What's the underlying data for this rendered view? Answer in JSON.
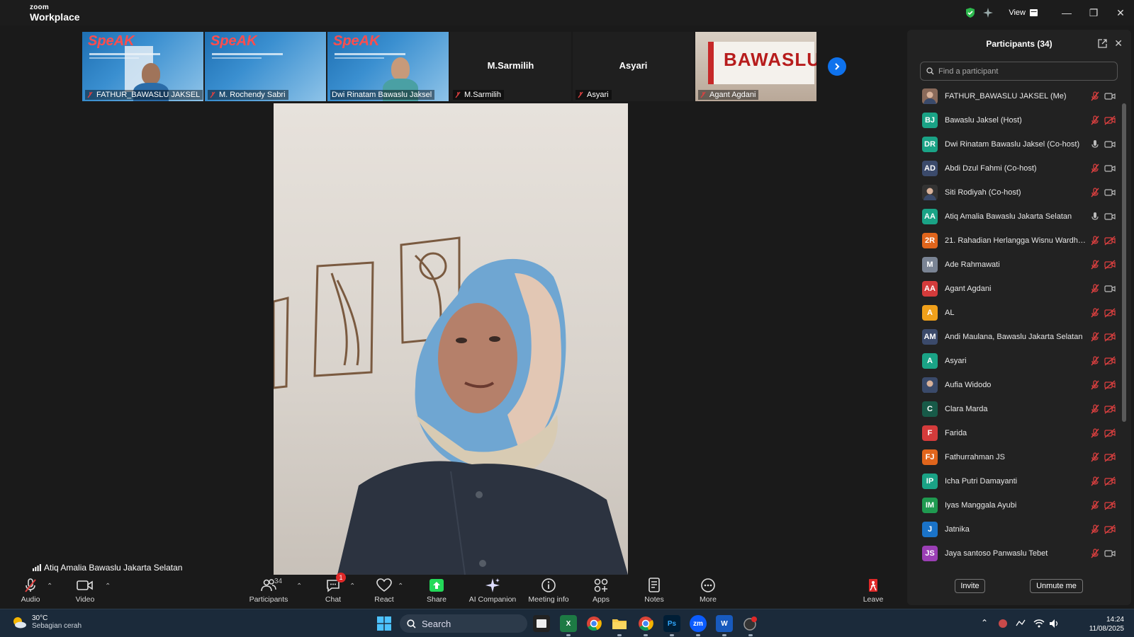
{
  "window": {
    "logo_line1": "zoom",
    "logo_line2": "Workplace",
    "view_label": "View"
  },
  "video_strip": [
    {
      "name": "FATHUR_BAWASLU JAKSEL",
      "kind": "slide",
      "slide_text": "SpeAK"
    },
    {
      "name": "M. Rochendy Sabri",
      "kind": "slide",
      "slide_text": "SpeAK"
    },
    {
      "name": "Dwi Rinatam Bawaslu Jaksel",
      "kind": "slide",
      "slide_text": "SpeAK"
    },
    {
      "name": "M.Sarmilih",
      "kind": "name_only",
      "center": "M.Sarmilih"
    },
    {
      "name": "Asyari",
      "kind": "name_only",
      "center": "Asyari"
    },
    {
      "name": "Agant Agdani",
      "kind": "sign",
      "sign_text": "BAWASLU"
    }
  ],
  "main_video": {
    "speaker_label": "Atiq Amalia Bawaslu Jakarta Selatan"
  },
  "toolbar": {
    "audio": "Audio",
    "video": "Video",
    "participants": "Participants",
    "participants_count": "34",
    "chat": "Chat",
    "chat_badge": "1",
    "react": "React",
    "share": "Share",
    "ai_companion": "AI Companion",
    "meeting_info": "Meeting info",
    "apps": "Apps",
    "notes": "Notes",
    "more": "More",
    "leave": "Leave"
  },
  "participants_panel": {
    "title": "Participants (34)",
    "search_placeholder": "Find a participant",
    "invite_label": "Invite",
    "unmute_label": "Unmute me",
    "items": [
      {
        "name": "FATHUR_BAWASLU JAKSEL (Me)",
        "initials": "",
        "color": "#8a6a5a",
        "photo": true,
        "mic": "muted",
        "cam": "on"
      },
      {
        "name": "Bawaslu Jaksel (Host)",
        "initials": "BJ",
        "color": "#1aa386",
        "mic": "muted",
        "cam": "off"
      },
      {
        "name": "Dwi Rinatam Bawaslu Jaksel (Co-host)",
        "initials": "DR",
        "color": "#1aa386",
        "mic": "on",
        "cam": "on"
      },
      {
        "name": "Abdi Dzul Fahmi (Co-host)",
        "initials": "AD",
        "color": "#3b4a6b",
        "mic": "muted",
        "cam": "on"
      },
      {
        "name": "Siti Rodiyah (Co-host)",
        "initials": "",
        "color": "#333333",
        "photo": true,
        "mic": "muted",
        "cam": "on"
      },
      {
        "name": "Atiq Amalia Bawaslu Jakarta Selatan",
        "initials": "AA",
        "color": "#1aa386",
        "mic": "on",
        "cam": "on"
      },
      {
        "name": "21. Rahadian Herlangga Wisnu Wardhana",
        "initials": "2R",
        "color": "#e0651c",
        "mic": "muted",
        "cam": "off"
      },
      {
        "name": "Ade Rahmawati",
        "initials": "M",
        "color": "#7a8494",
        "mic": "muted",
        "cam": "off"
      },
      {
        "name": "Agant Agdani",
        "initials": "AA",
        "color": "#d43b3b",
        "mic": "muted",
        "cam": "on"
      },
      {
        "name": "AL",
        "initials": "A",
        "color": "#f0a01a",
        "mic": "muted",
        "cam": "off"
      },
      {
        "name": "Andi Maulana, Bawaslu Jakarta Selatan",
        "initials": "AM",
        "color": "#3b4a6b",
        "mic": "muted",
        "cam": "off"
      },
      {
        "name": "Asyari",
        "initials": "A",
        "color": "#1aa386",
        "mic": "muted",
        "cam": "off"
      },
      {
        "name": "Aufia Widodo",
        "initials": "",
        "color": "#3a4a6a",
        "photo": true,
        "mic": "muted",
        "cam": "off"
      },
      {
        "name": "Clara Marda",
        "initials": "C",
        "color": "#175a48",
        "mic": "muted",
        "cam": "off"
      },
      {
        "name": "Farida",
        "initials": "F",
        "color": "#d43b3b",
        "mic": "muted",
        "cam": "off"
      },
      {
        "name": "Fathurrahman JS",
        "initials": "FJ",
        "color": "#e0651c",
        "mic": "muted",
        "cam": "off"
      },
      {
        "name": "Icha Putri Damayanti",
        "initials": "IP",
        "color": "#1aa386",
        "mic": "muted",
        "cam": "off"
      },
      {
        "name": "Iyas Manggala Ayubi",
        "initials": "IM",
        "color": "#1f9a50",
        "mic": "muted",
        "cam": "off"
      },
      {
        "name": "Jatnika",
        "initials": "J",
        "color": "#1a73c8",
        "mic": "muted",
        "cam": "off"
      },
      {
        "name": "Jaya santoso Panwaslu Tebet",
        "initials": "JS",
        "color": "#9b3fb5",
        "mic": "muted",
        "cam": "on"
      }
    ]
  },
  "taskbar": {
    "temperature": "30°C",
    "weather_desc": "Sebagian cerah",
    "search_label": "Search",
    "time": "14:24",
    "date": "11/08/2025"
  },
  "colors": {
    "accent": "#0e72ed",
    "muted_red": "#e04040",
    "share_green": "#23d959"
  }
}
